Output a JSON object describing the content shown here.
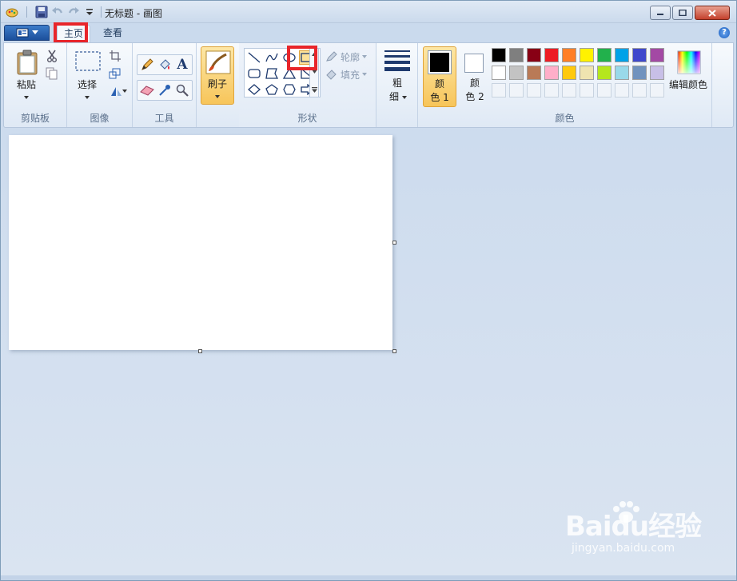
{
  "window": {
    "title": "无标题 - 画图",
    "accent": "#1b4f9b"
  },
  "tabs": [
    {
      "label": "主页",
      "active": true
    },
    {
      "label": "查看",
      "active": false
    }
  ],
  "help_icon": "?",
  "groups": {
    "clipboard": {
      "label": "剪贴板",
      "paste_label": "粘贴",
      "icons": [
        "clipboard-icon",
        "cut-icon",
        "copy-icon"
      ]
    },
    "image": {
      "label": "图像",
      "select_label": "选择",
      "icons": [
        "select-rect-icon",
        "crop-icon",
        "resize-icon",
        "rotate-icon"
      ]
    },
    "tools": {
      "label": "工具",
      "text_glyph": "A",
      "icons": [
        "pencil-icon",
        "fill-icon",
        "text-icon",
        "eraser-icon",
        "color-picker-icon",
        "magnifier-icon"
      ]
    },
    "brush": {
      "label": "刷子"
    },
    "shapes": {
      "label": "形状",
      "outline_label": "轮廓",
      "fill_label": "填充",
      "items": [
        "line",
        "curve",
        "oval",
        "rectangle",
        "rounded-rectangle",
        "polygon",
        "triangle",
        "right-triangle",
        "diamond",
        "pentagon",
        "hexagon",
        "right-arrow"
      ]
    },
    "size": {
      "label_line1": "粗",
      "label_line2": "细"
    },
    "colors": {
      "label": "颜色",
      "color1_line1": "颜",
      "color1_line2": "色 1",
      "color2_line1": "颜",
      "color2_line2": "色 2",
      "edit_label": "编辑颜色",
      "color1": "#000000",
      "color2": "#ffffff",
      "row1": [
        "#000000",
        "#7f7f7f",
        "#880015",
        "#ed1c24",
        "#ff7f27",
        "#fff200",
        "#22b14c",
        "#00a2e8",
        "#3f48cc",
        "#a349a4"
      ],
      "row2": [
        "#ffffff",
        "#c3c3c3",
        "#b97a57",
        "#ffaec9",
        "#ffc90e",
        "#efe4b0",
        "#b5e61d",
        "#99d9ea",
        "#7092be",
        "#c8bfe7"
      ]
    }
  },
  "watermark": {
    "logo": "Baidu经验",
    "url": "jingyan.baidu.com"
  }
}
